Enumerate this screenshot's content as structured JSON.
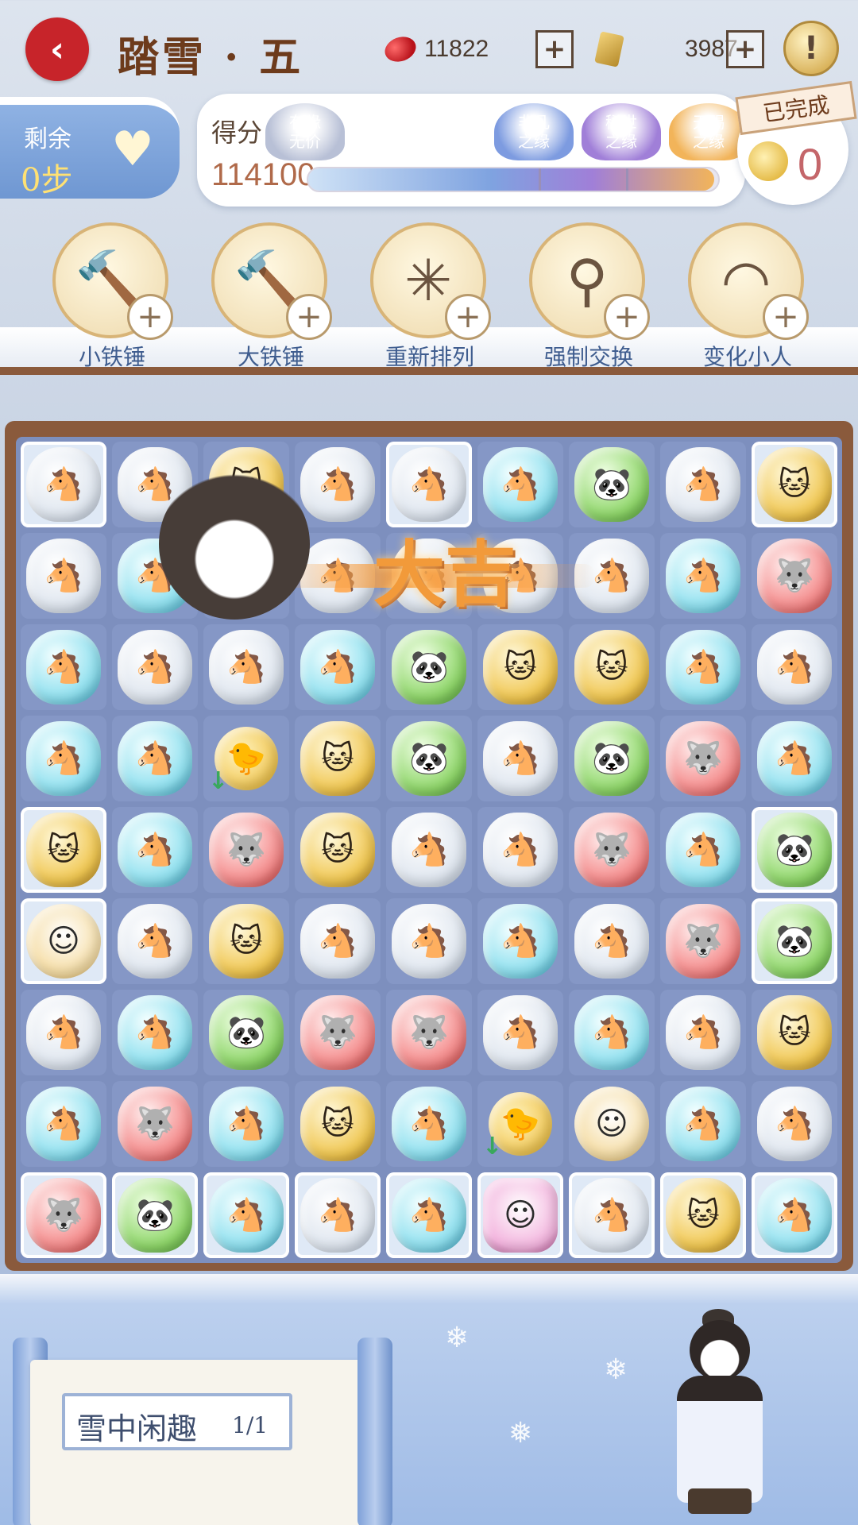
{
  "header": {
    "back_icon": "chevron-left-icon",
    "level_title": "踏雪 · 五",
    "gems": "11822",
    "tickets": "3987",
    "plus": "+",
    "info": "!"
  },
  "steps": {
    "label": "剩余",
    "value": "0步"
  },
  "score": {
    "label": "得分",
    "value": "114100",
    "progress_percent": 99,
    "tiers": [
      {
        "line1": "有缘",
        "line2": "无价",
        "color": "#b8c0d6"
      },
      {
        "line1": "非凡",
        "line2": "之缘",
        "color": "#7d9be0"
      },
      {
        "line1": "稀世",
        "line2": "之缘",
        "color": "#a07fd8"
      },
      {
        "line1": "天赐",
        "line2": "之缘",
        "color": "#f2b45a"
      }
    ]
  },
  "completed": {
    "label": "已完成",
    "value": "0"
  },
  "tools": [
    {
      "label": "小铁锤",
      "icon": "small-hammer-icon",
      "glyph": "🔨"
    },
    {
      "label": "大铁锤",
      "icon": "big-hammer-icon",
      "glyph": "🔨"
    },
    {
      "label": "重新排列",
      "icon": "pinwheel-icon",
      "glyph": "✳"
    },
    {
      "label": "强制交换",
      "icon": "whisk-icon",
      "glyph": "⚲"
    },
    {
      "label": "变化小人",
      "icon": "fan-icon",
      "glyph": "◠"
    }
  ],
  "combo_text": "大吉",
  "board": {
    "rows": [
      [
        "clear",
        "clear",
        "gold",
        "clear",
        "clear",
        "cyan",
        "green",
        "clear",
        "gold"
      ],
      [
        "clear",
        "cyan",
        "clear",
        "clear",
        "clear",
        "clear",
        "clear",
        "cyan",
        "red"
      ],
      [
        "cyan",
        "clear",
        "clear",
        "cyan",
        "green",
        "gold",
        "gold",
        "cyan",
        "clear"
      ],
      [
        "cyan",
        "cyan",
        "bird",
        "gold",
        "green",
        "clear",
        "green",
        "red",
        "cyan"
      ],
      [
        "gold",
        "cyan",
        "red",
        "gold",
        "clear",
        "clear",
        "red",
        "cyan",
        "green"
      ],
      [
        "girl",
        "clear",
        "gold",
        "clear",
        "clear",
        "cyan",
        "clear",
        "red",
        "green"
      ],
      [
        "clear",
        "cyan",
        "green",
        "red",
        "red",
        "clear",
        "cyan",
        "clear",
        "gold"
      ],
      [
        "cyan",
        "red",
        "cyan",
        "gold",
        "cyan",
        "bird",
        "girl",
        "cyan",
        "clear"
      ],
      [
        "red",
        "green",
        "cyan",
        "clear",
        "cyan",
        "pink",
        "clear",
        "gold",
        "cyan"
      ]
    ],
    "ice": [
      [
        0,
        0
      ],
      [
        0,
        4
      ],
      [
        0,
        8
      ],
      [
        4,
        0
      ],
      [
        4,
        8
      ],
      [
        5,
        0
      ],
      [
        5,
        8
      ],
      [
        8,
        0
      ],
      [
        8,
        1
      ],
      [
        8,
        2
      ],
      [
        8,
        3
      ],
      [
        8,
        4
      ],
      [
        8,
        5
      ],
      [
        8,
        6
      ],
      [
        8,
        7
      ],
      [
        8,
        8
      ]
    ]
  },
  "task": {
    "name": "雪中闲趣",
    "count": "1/1"
  }
}
